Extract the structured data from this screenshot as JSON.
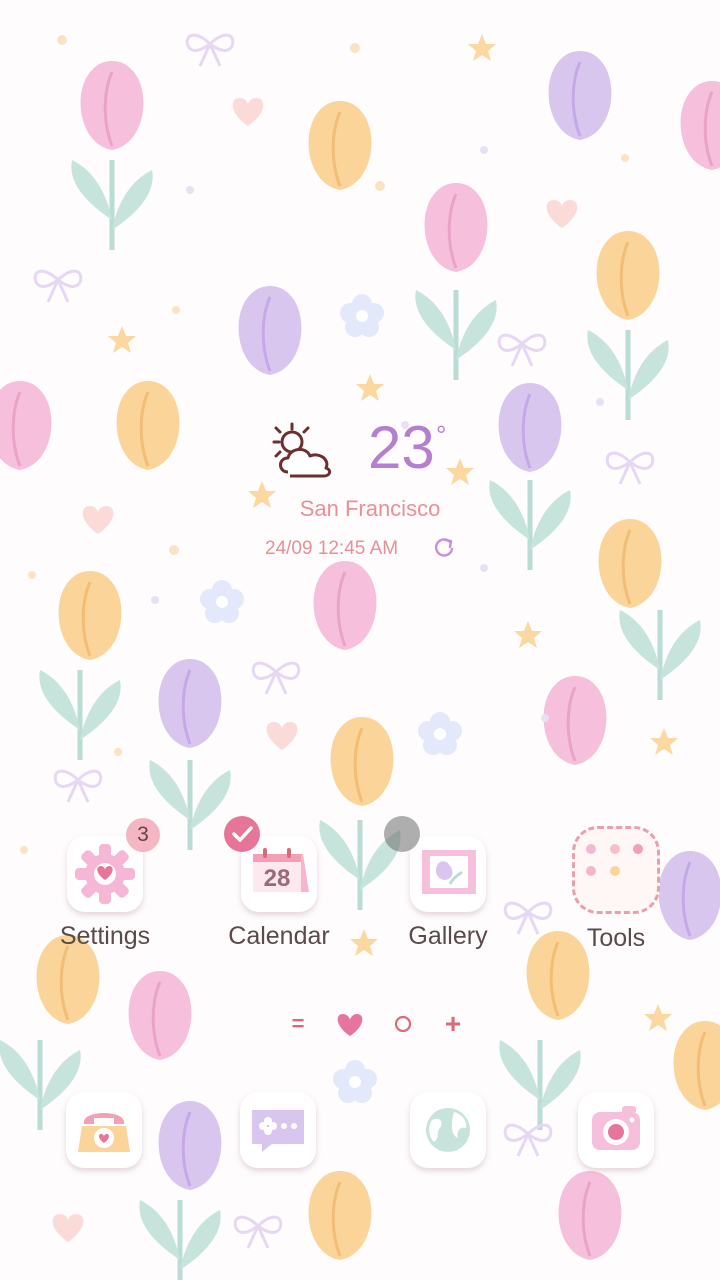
{
  "weather": {
    "temperature": "23",
    "degree_symbol": "°",
    "city": "San Francisco",
    "datetime": "24/09 12:45 AM",
    "condition_icon": "partly-cloudy-sun-icon"
  },
  "home_apps": [
    {
      "label": "Settings",
      "icon": "gear-heart-icon",
      "badge": "3"
    },
    {
      "label": "Calendar",
      "icon": "calendar-icon",
      "date": "28"
    },
    {
      "label": "Gallery",
      "icon": "tulip-picture-icon"
    },
    {
      "label": "Tools",
      "icon": "folder-icon"
    }
  ],
  "page_indicator": [
    "=",
    "heart",
    "circle",
    "+"
  ],
  "dock": [
    {
      "icon": "telephone-icon"
    },
    {
      "icon": "message-bubble-icon"
    },
    {
      "icon": "globe-icon"
    },
    {
      "icon": "camera-icon"
    }
  ],
  "colors": {
    "accent_pink": "#e7759a",
    "temperature_purple": "#b57fd1",
    "label_brown": "#5a4a4a",
    "city_pink": "#e98f96"
  }
}
